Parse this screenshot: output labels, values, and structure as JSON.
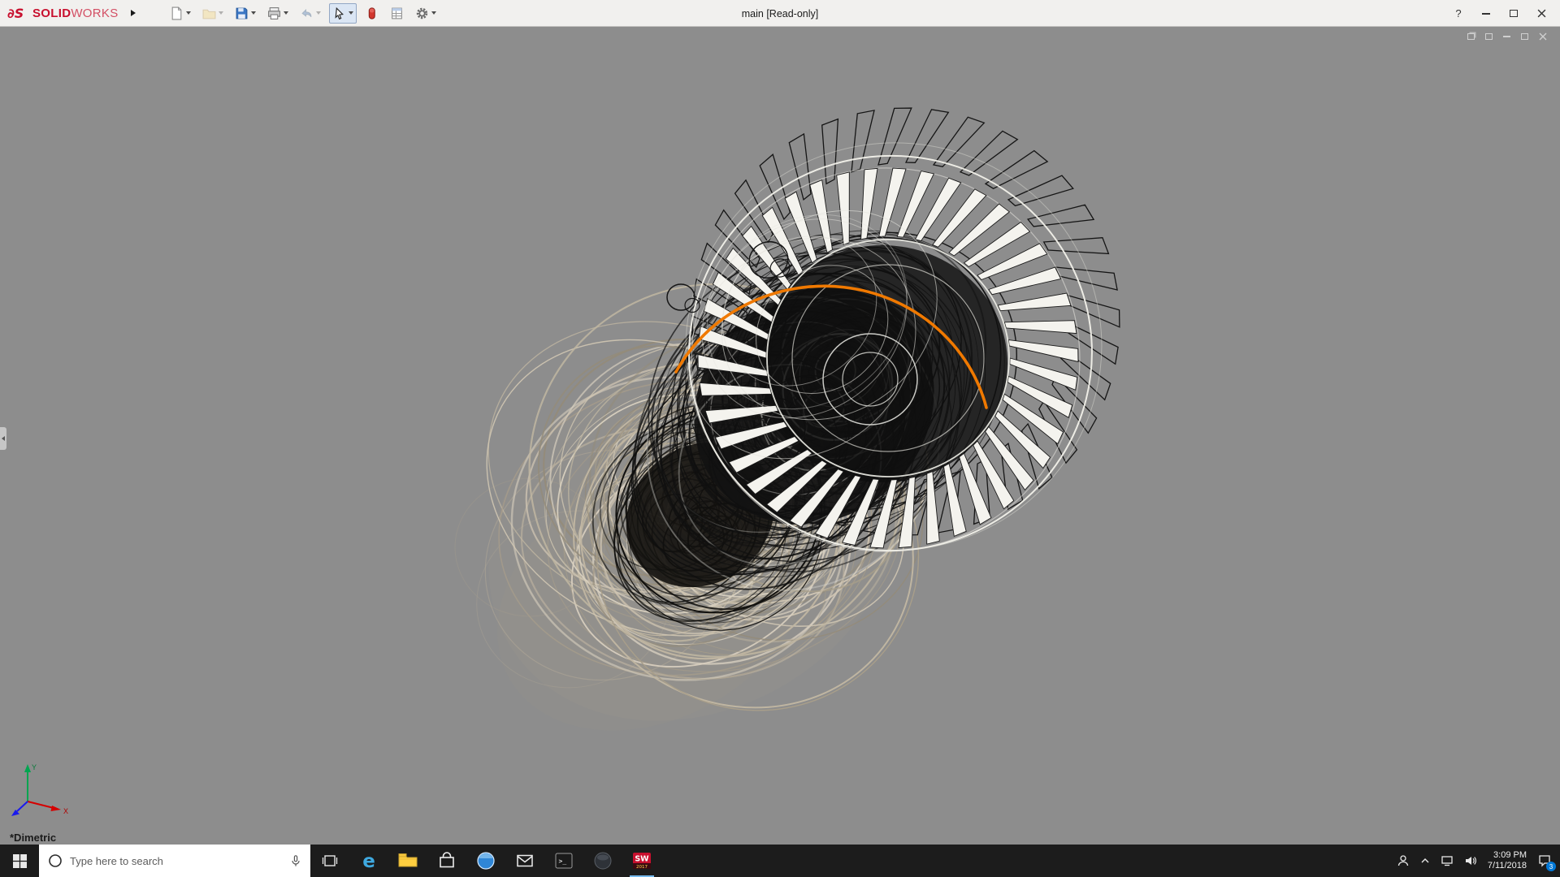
{
  "app": {
    "logo_mark": "∂S",
    "logo_solid": "SOLID",
    "logo_works": "WORKS",
    "title": "main [Read-only]",
    "help_label": "?"
  },
  "toolbar": {
    "items": [
      {
        "name": "new-document",
        "dropdown": true
      },
      {
        "name": "open",
        "dropdown": true,
        "disabled": true
      },
      {
        "name": "save",
        "dropdown": true
      },
      {
        "name": "print",
        "dropdown": true
      },
      {
        "name": "undo",
        "dropdown": true,
        "disabled": true
      },
      {
        "name": "select",
        "dropdown": true,
        "active": true
      },
      {
        "name": "appearance",
        "dropdown": false
      },
      {
        "name": "properties",
        "dropdown": false
      },
      {
        "name": "options",
        "dropdown": true
      }
    ]
  },
  "viewport": {
    "view_label": "*Dimetric",
    "background": "#8d8d8d",
    "highlight_color": "#f07900",
    "triad": {
      "x_label": "X",
      "y_label": "Y"
    },
    "engine": {
      "tan_colors": [
        "#cfc5b2",
        "#bfb5a1",
        "#a89e8a",
        "#948b79",
        "#d9d0c0"
      ],
      "wire_color": "#101010",
      "blade_fill": "#f4f3ee",
      "rim_color": "#f2f1ea"
    }
  },
  "taskbar": {
    "search_placeholder": "Type here to search",
    "icons": [
      {
        "name": "task-view"
      },
      {
        "name": "edge",
        "glyph": "e"
      },
      {
        "name": "file-explorer"
      },
      {
        "name": "store"
      },
      {
        "name": "browser"
      },
      {
        "name": "mail"
      },
      {
        "name": "terminal",
        "glyph": ">_"
      },
      {
        "name": "app-sphere"
      },
      {
        "name": "solidworks-2017",
        "glyph": "SW",
        "sub": "2017",
        "running": true
      }
    ],
    "tray": {
      "time": "3:09 PM",
      "date": "7/11/2018",
      "badge": "3"
    }
  }
}
